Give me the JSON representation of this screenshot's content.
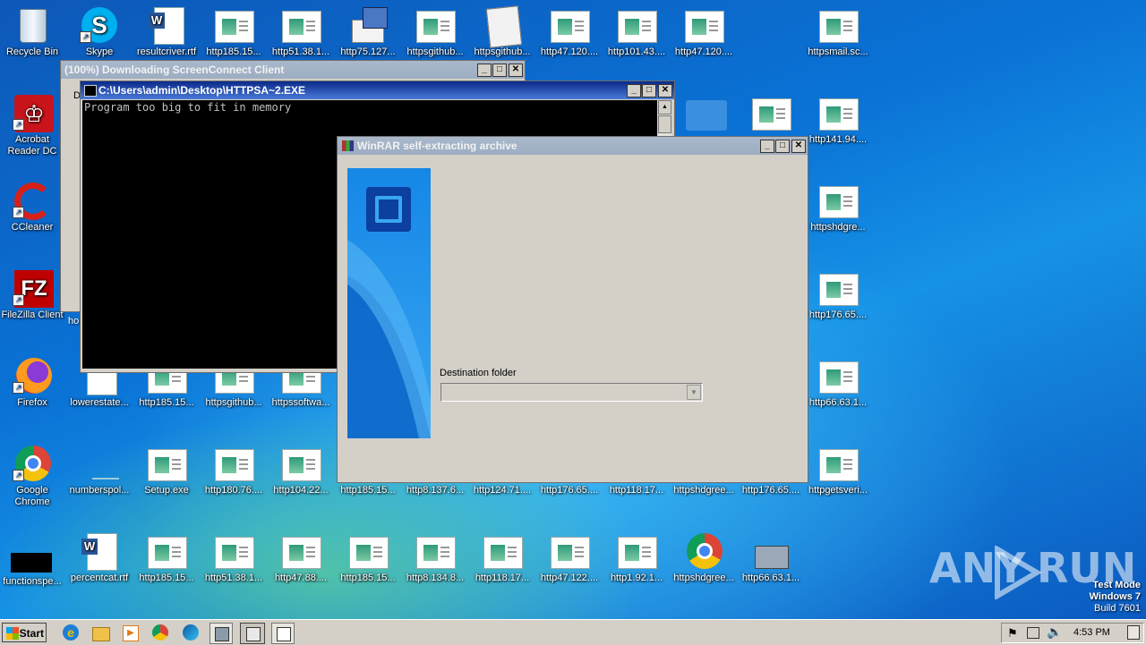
{
  "desktop": {
    "icons_left": [
      {
        "label": "Recycle Bin",
        "icon": "recycle-bin-icon"
      },
      {
        "label": "Acrobat Reader DC",
        "icon": "acrobat-icon"
      },
      {
        "label": "CCleaner",
        "icon": "ccleaner-icon"
      },
      {
        "label": "FileZilla Client",
        "icon": "filezilla-icon"
      },
      {
        "label": "Firefox",
        "icon": "firefox-icon"
      },
      {
        "label": "Google Chrome",
        "icon": "chrome-icon"
      },
      {
        "label": "functionspe...",
        "icon": "black-file-icon"
      }
    ],
    "row1": [
      "Skype",
      "resultcriver.rtf",
      "http185.15...",
      "http51.38.1...",
      "http75.127...",
      "httpsgithub...",
      "httpsgithub...",
      "http47.120....",
      "http101.43....",
      "http47.120....",
      "httpsmail.sc..."
    ],
    "col_right": [
      "http141.94....",
      "httpshdgre...",
      "http176.65....",
      "http66.63.1..."
    ],
    "row5": [
      "numberspol...",
      "lowerestate...",
      "http185.15...",
      "httpsgithub...",
      "httpssoftwa..."
    ],
    "row6": [
      "Setup.exe",
      "http180.76....",
      "http104.22...",
      "http185.15...",
      "http8.137.6...",
      "http124.71....",
      "http176.65....",
      "http118.17...",
      "httpshdgree...",
      "http176.65....",
      "httpgetsveri..."
    ],
    "row7": [
      "percentcat.rtf",
      "http185.15...",
      "http51.38.1...",
      "http47.88....",
      "http185.15...",
      "http8.134.8...",
      "http118.17...",
      "http47.122....",
      "http1.92.1...",
      "httpshdgree...",
      "http66.63.1..."
    ],
    "partial_label": "ho"
  },
  "window_download": {
    "title": "(100%) Downloading ScreenConnect Client",
    "body_partial": "D"
  },
  "window_cmd": {
    "title": "C:\\Users\\admin\\Desktop\\HTTPSA~2.EXE",
    "output": "Program too big to fit in memory"
  },
  "window_winrar": {
    "title": "WinRAR self-extracting archive",
    "dest_label": "Destination folder",
    "dest_value": ""
  },
  "watermark": {
    "brand_left": "ANY",
    "brand_right": "RUN",
    "mode": "Test Mode",
    "os": "Windows 7",
    "build": "Build 7601"
  },
  "taskbar": {
    "start_label": "Start",
    "clock": "4:53 PM"
  }
}
